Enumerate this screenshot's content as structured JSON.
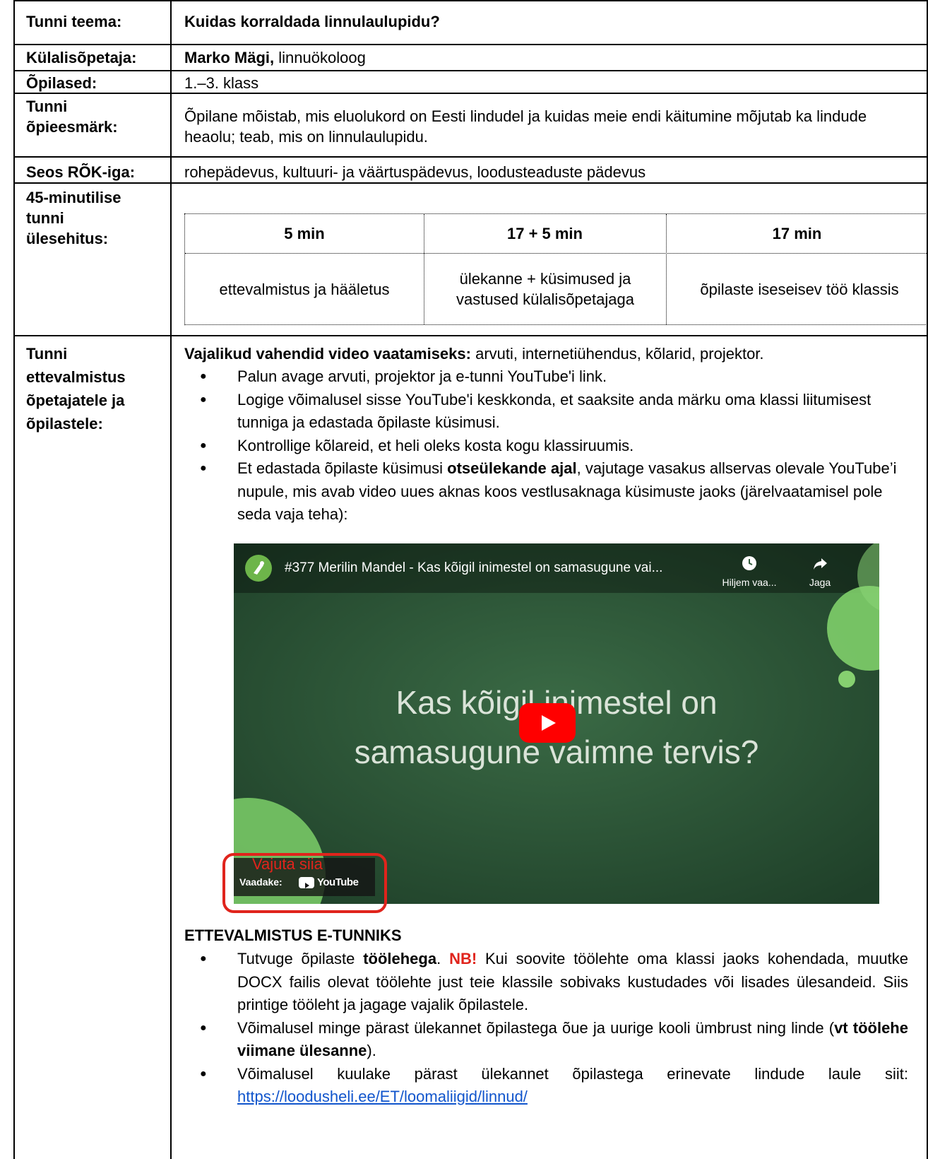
{
  "rows": {
    "teema": {
      "label": "Tunni teema:",
      "value": "Kuidas korraldada linnulaulupidu?"
    },
    "kylaline": {
      "label": "Külalisõpetaja:",
      "name": "Marko Mägi,",
      "role": " linnuökoloog"
    },
    "opilased": {
      "label": "Õpilased:",
      "value": "1.–3. klass"
    },
    "eesmark": {
      "label_1": "Tunni",
      "label_2": "õpieesmärk:",
      "value": "Õpilane mõistab, mis eluolukord on Eesti lindudel ja kuidas meie endi käitumine mõjutab ka lindude heaolu; teab, mis on linnulaulupidu."
    },
    "seos": {
      "label": "Seos RÕK-iga:",
      "value": "rohepädevus, kultuuri- ja väärtuspädevus, loodusteaduste pädevus"
    },
    "ylesehitus": {
      "label_1": "45-minutilise",
      "label_2": "tunni",
      "label_3": "ülesehitus:",
      "schedule": [
        {
          "time": "5 min",
          "activity": "ettevalmistus ja hääletus"
        },
        {
          "time": "17 + 5 min",
          "activity": "ülekanne + küsimused ja vastused külalisõpetajaga"
        },
        {
          "time": "17 min",
          "activity": "õpilaste iseseisev töö klassis"
        }
      ]
    },
    "ettevalmistus": {
      "label_1": "Tunni",
      "label_2": "ettevalmistus",
      "label_3": "õpetajatele ja",
      "label_4": "õpilastele:",
      "intro_bold": "Vajalikud vahendid video vaatamiseks:",
      "intro_rest": " arvuti, internetiühendus, kõlarid, projektor.",
      "bullets1": [
        "Palun avage arvuti, projektor ja e-tunni YouTube'i link.",
        "Logige võimalusel sisse YouTube'i keskkonda, et saaksite anda märku oma klassi liitumisest tunniga ja edastada õpilaste küsimusi.",
        "Kontrollige kõlareid, et heli oleks kosta kogu klassiruumis."
      ],
      "b4_pre": "Et edastada õpilaste küsimusi ",
      "b4_bold": "otseülekande ajal",
      "b4_post": ", vajutage vasakus allservas olevale YouTube’i nupule, mis avab video uues aknas koos vestlusaknaga küsimuste jaoks (järelvaatamisel pole seda vaja teha):",
      "section_title": "ETTEVALMISTUS E-TUNNIKS",
      "s1_pre": "Tutvuge õpilaste ",
      "s1_bold": "töölehega",
      "s1_mid": ". ",
      "s1_nb": "NB!",
      "s1_post": " Kui soovite töölehte oma klassi jaoks kohendada, muutke DOCX failis olevat töölehte just teie klassile sobivaks kustudades või lisades ülesandeid. Siis printige tööleht ja jagage vajalik õpilastele.",
      "s2_pre": "Võimalusel minge pärast ülekannet õpilastega õue ja uurige kooli ümbrust ning linde (",
      "s2_bold": "vt töölehe viimane ülesanne",
      "s2_post": ").",
      "s3_pre": "Võimalusel kuulake pärast ülekannet õpilastega erinevate lindude laule siit: ",
      "s3_link": "https://loodusheli.ee/ET/loomaliigid/linnud/"
    }
  },
  "video": {
    "title": "#377 Merilin Mandel - Kas kõigil inimestel on samasugune vai...",
    "later_label": "Hiljem vaa...",
    "share_label": "Jaga",
    "board_line1": "Kas kõigil inimestel on",
    "board_line2": "samasugune vaimne tervis?",
    "hint": "Vajuta siia",
    "watch_on": "Vaadake:",
    "youtube": "YouTube"
  },
  "colors": {
    "accent_red": "#e0241c",
    "link": "#1155cc",
    "board_green": "#2a5535"
  }
}
